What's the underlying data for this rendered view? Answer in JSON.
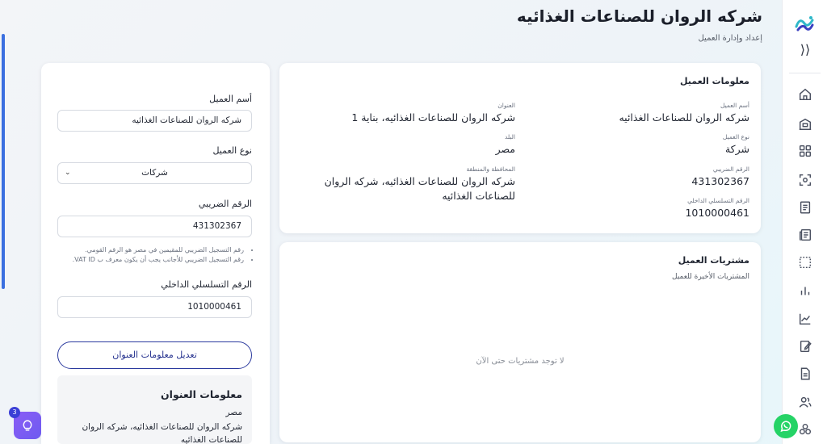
{
  "header": {
    "title": "شركه الروان للصناعات الغذائيه",
    "subtitle": "إعداد وإدارة العميل"
  },
  "customer_info": {
    "title": "معلومات العميل",
    "name_label": "أسم العميل",
    "name_value": "شركه الروان للصناعات الغذائيه",
    "type_label": "نوع العميل",
    "type_value": "شركة",
    "tax_label": "الرقم الضريبي",
    "tax_value": "431302367",
    "serial_label": "الرقم التسلسلي الداخلي",
    "serial_value": "1010000461",
    "address_label": "العنوان",
    "address_value": "شركه الروان للصناعات الغذائيه، بناية 1",
    "country_label": "البلد",
    "country_value": "مصر",
    "region_label": "المحافظة والمنطقة",
    "region_value": "شركه الروان للصناعات الغذائيه، شركه الروان للصناعات الغذائيه"
  },
  "purchases": {
    "title": "مشتريات العميل",
    "subtitle": "المشتريات الأخيرة للعميل",
    "empty_message": "لا توجد مشتريات حتى الآن"
  },
  "form": {
    "name_label": "أسم العميل",
    "name_value": "شركه الروان للصناعات الغذائيه",
    "type_label": "نوع العميل",
    "type_value": "شركات",
    "tax_label": "الرقم الضريبي",
    "tax_value": "431302367",
    "note_1": "رقم التسجيل الضريبي للمقيمين في مصر هو الرقم القومي.",
    "note_2": "رقم التسجيل الضريبي للأجانب يجب أن يكون معرف ب VAT ID.",
    "serial_label": "الرقم التسلسلي الداخلي",
    "serial_value": "1010000461",
    "edit_address_button": "تعديل معلومات العنوان",
    "address_box_title": "معلومات العنوان",
    "address_box_country": "مصر",
    "address_box_line": "شركه الروان للصناعات الغذائيه، شركه الروان للصناعات الغذائيه"
  },
  "help": {
    "badge_count": "3"
  },
  "nav": {
    "items": [
      "home-icon",
      "building-icon",
      "grid-icon",
      "scan-icon",
      "document-icon",
      "newspaper-icon",
      "selection-icon",
      "bar-chart-icon",
      "line-chart-icon",
      "edit-note-icon",
      "invoice-icon",
      "users-icon",
      "integrations-icon"
    ]
  },
  "colors": {
    "primary": "#2b3a9e",
    "accent_scroll": "#3b6fe0",
    "whatsapp": "#25d366",
    "help_gradient": "#8b5cf6"
  }
}
